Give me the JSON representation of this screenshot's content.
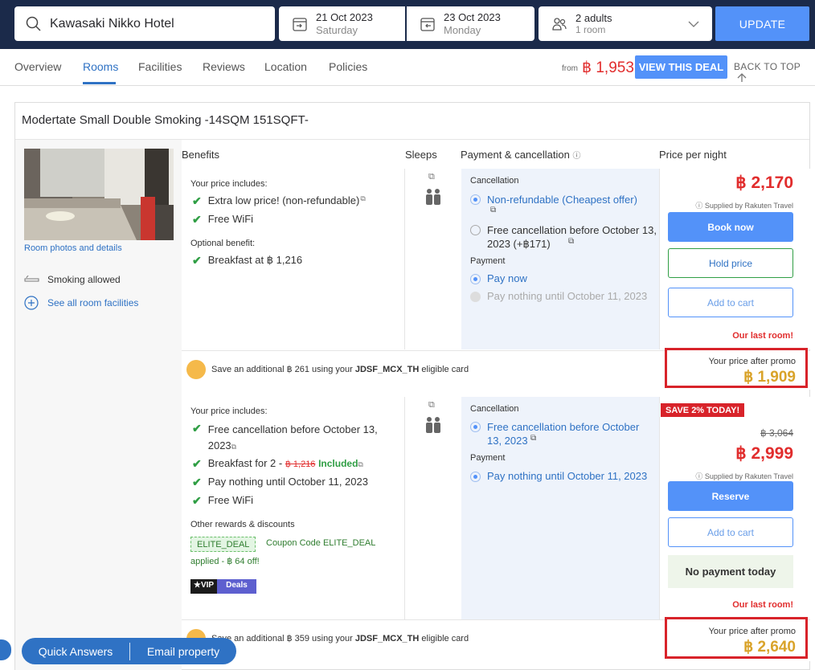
{
  "search": {
    "hotel": "Kawasaki Nikko Hotel",
    "checkin_date": "21 Oct 2023",
    "checkin_day": "Saturday",
    "checkout_date": "23 Oct 2023",
    "checkout_day": "Monday",
    "guests": "2 adults",
    "rooms": "1 room",
    "update_label": "UPDATE"
  },
  "nav": {
    "tabs": [
      "Overview",
      "Rooms",
      "Facilities",
      "Reviews",
      "Location",
      "Policies"
    ],
    "active": "Rooms",
    "from_label": "from",
    "from_price": "฿ 1,953",
    "deal_button": "VIEW THIS DEAL",
    "back_to_top": "BACK TO TOP"
  },
  "room": {
    "title": "Modertate Small Double Smoking -14SQM 151SQFT-",
    "photos_link": "Room photos and details",
    "smoking": "Smoking allowed",
    "facilities_link": "See all room facilities",
    "headers": {
      "benefits": "Benefits",
      "sleeps": "Sleeps",
      "payment": "Payment & cancellation",
      "price": "Price per night"
    }
  },
  "offer1": {
    "includes_title": "Your price includes:",
    "includes": [
      "Extra low price! (non-refundable)",
      "Free WiFi"
    ],
    "optional_title": "Optional benefit:",
    "optional": "Breakfast at ฿ 1,216",
    "cancellation_title": "Cancellation",
    "cancel_opt1": "Non-refundable (Cheapest offer)",
    "cancel_opt2": "Free cancellation before October 13, 2023 (+฿171)",
    "payment_title": "Payment",
    "pay_opt1": "Pay now",
    "pay_opt2": "Pay nothing until October 11, 2023",
    "price": "฿ 2,170",
    "supplier": "Supplied by Rakuten Travel",
    "book_now": "Book now",
    "hold_price": "Hold price",
    "add_to_cart": "Add to cart",
    "last_room": "Our last room!",
    "card_save_pre": "Save an additional ฿ 261 using your",
    "card_name": "JDSF_MCX_TH",
    "card_save_post": "eligible card",
    "promo_label": "Your price after promo",
    "promo_price": "฿ 1,909"
  },
  "offer2": {
    "includes_title": "Your price includes:",
    "include1": "Free cancellation before October 13, 2023",
    "breakfast_pre": "Breakfast for 2 -",
    "breakfast_strike": "฿ 1,216",
    "breakfast_included": "Included",
    "include3": "Pay nothing until October 11, 2023",
    "include4": "Free WiFi",
    "rewards_title": "Other rewards & discounts",
    "coupon_tag": "ELITE_DEAL",
    "coupon_text": "Coupon Code ELITE_DEAL",
    "coupon_applied": "applied - ฿ 64 off!",
    "vip": "VIP",
    "deals": "Deals",
    "cancellation_title": "Cancellation",
    "cancel_opt1": "Free cancellation before October 13, 2023",
    "payment_title": "Payment",
    "pay_opt1": "Pay nothing until October 11, 2023",
    "save_badge": "SAVE 2% TODAY!",
    "old_price": "฿ 3,064",
    "price": "฿ 2,999",
    "supplier": "Supplied by Rakuten Travel",
    "reserve": "Reserve",
    "add_to_cart": "Add to cart",
    "no_payment": "No payment today",
    "last_room": "Our last room!",
    "card_save_pre": "Save an additional ฿ 359 using your",
    "card_name": "JDSF_MCX_TH",
    "card_save_post": "eligible card",
    "promo_label": "Your price after promo",
    "promo_price": "฿ 2,640"
  },
  "floating": {
    "quick_answers": "Quick Answers",
    "email_property": "Email property"
  },
  "colors": {
    "navy": "#1b2a4a",
    "primary": "#5392f9",
    "price_red": "#e12d2d",
    "promo_gold": "#d9a32a",
    "highlight_border": "#d8232a"
  }
}
